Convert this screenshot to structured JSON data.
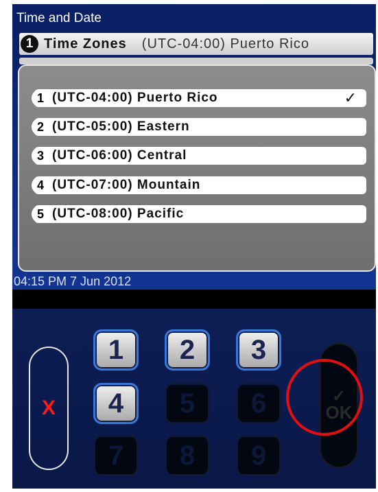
{
  "header": {
    "title": "Time and Date",
    "row1": {
      "number": "1",
      "label": "Time Zones",
      "value": "(UTC-04:00) Puerto Rico"
    }
  },
  "popup": {
    "options": [
      {
        "number": "1",
        "label": "(UTC-04:00) Puerto Rico",
        "check": "✓"
      },
      {
        "number": "2",
        "label": "(UTC-05:00) Eastern"
      },
      {
        "number": "3",
        "label": "(UTC-06:00) Central"
      },
      {
        "number": "4",
        "label": "(UTC-07:00) Mountain"
      },
      {
        "number": "5",
        "label": "(UTC-08:00) Pacific"
      }
    ]
  },
  "status": {
    "datetime": "04:15 PM 7 Jun 2012"
  },
  "keypad": {
    "cancel_label": "X",
    "keys": [
      "1",
      "2",
      "3",
      "4",
      "5",
      "6",
      "7",
      "8",
      "9"
    ],
    "ok_check": "✓",
    "ok_label": "OK"
  },
  "colors": {
    "highlight": "#e01010",
    "key_border": "#3a78d8",
    "cancel": "#ff1a1a"
  }
}
